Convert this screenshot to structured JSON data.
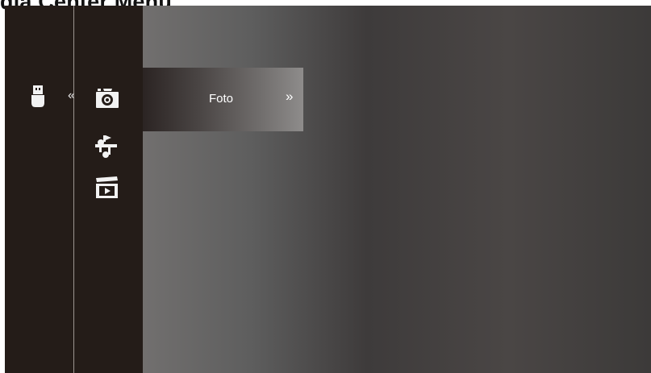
{
  "header": {
    "title": "dia Center Menü"
  },
  "sidebar": {
    "source_icon": "usb-drive-icon",
    "back_indicator": "«",
    "items": [
      {
        "icon": "camera-icon",
        "label": "Foto",
        "selected": true
      },
      {
        "icon": "music-icon",
        "selected": false
      },
      {
        "icon": "video-icon",
        "selected": false
      }
    ]
  },
  "menu": {
    "selected_label": "Foto",
    "forward_indicator": "»"
  },
  "colors": {
    "sidebar_bg": "#241c18",
    "icon": "#f2f2f2",
    "text": "#ffffff"
  }
}
